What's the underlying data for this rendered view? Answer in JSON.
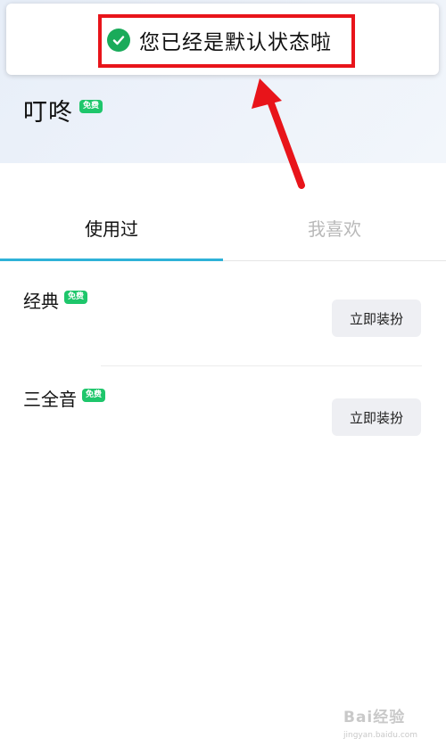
{
  "toast": {
    "message": "您已经是默认状态啦",
    "icon": "check-circle-icon",
    "highlight_color": "#e8141a"
  },
  "header": {
    "title": "叮咚",
    "badge": "免费"
  },
  "tabs": [
    {
      "label": "使用过",
      "active": true
    },
    {
      "label": "我喜欢",
      "active": false
    }
  ],
  "items": [
    {
      "name": "经典",
      "badge": "免费",
      "action_label": "立即装扮"
    },
    {
      "name": "三全音",
      "badge": "免费",
      "action_label": "立即装扮"
    }
  ],
  "watermark": {
    "brand": "Bai经验",
    "url": "jingyan.baidu.com"
  },
  "colors": {
    "accent": "#2fb2d8",
    "badge_green": "#1ec66b",
    "check_green": "#1aab5a",
    "arrow_red": "#e8141a"
  }
}
